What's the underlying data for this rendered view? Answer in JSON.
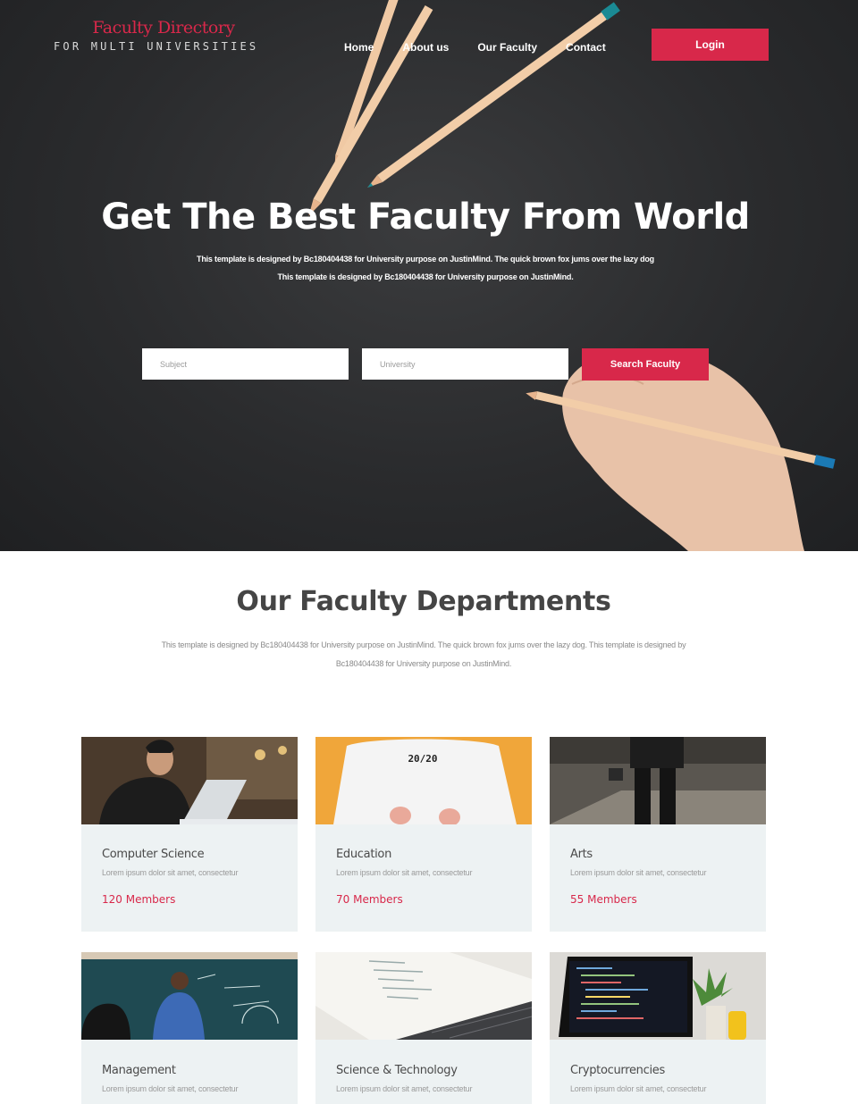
{
  "brand": {
    "title": "Faculty Directory",
    "subtitle": "FOR MULTI UNIVERSITIES"
  },
  "nav": {
    "items": [
      "Home",
      "About us",
      "Our Faculty",
      "Contact"
    ],
    "login_label": "Login"
  },
  "hero": {
    "title": "Get The Best Faculty From World",
    "subtitle_line1": "This template is designed by Bc180404438 for University purpose on JustinMind. The quick brown fox jums over the lazy dog",
    "subtitle_line2": "This template is designed by Bc180404438 for University purpose on JustinMind."
  },
  "search": {
    "subject_placeholder": "Subject",
    "university_placeholder": "University",
    "button_label": "Search Faculty"
  },
  "departments": {
    "title": "Our Faculty Departments",
    "description": "This template is designed by Bc180404438 for University purpose on JustinMind. The quick brown fox jums over the lazy dog. This template is designed by Bc180404438 for University purpose on JustinMind.",
    "cards": [
      {
        "title": "Computer Science",
        "desc": "Lorem ipsum dolor sit amet, consectetur",
        "members": "120 Members"
      },
      {
        "title": "Education",
        "desc": "Lorem ipsum dolor sit amet, consectetur",
        "members": "70 Members"
      },
      {
        "title": "Arts",
        "desc": "Lorem ipsum dolor sit amet, consectetur",
        "members": "55 Members"
      },
      {
        "title": "Management",
        "desc": "Lorem ipsum dolor sit amet, consectetur"
      },
      {
        "title": "Science & Technology",
        "desc": "Lorem ipsum dolor sit amet, consectetur"
      },
      {
        "title": "Cryptocurrencies",
        "desc": "Lorem ipsum dolor sit amet, consectetur"
      }
    ]
  },
  "colors": {
    "accent": "#d8284a",
    "hero_bg": "#2a2b2d",
    "card_bg": "#edf2f3"
  }
}
